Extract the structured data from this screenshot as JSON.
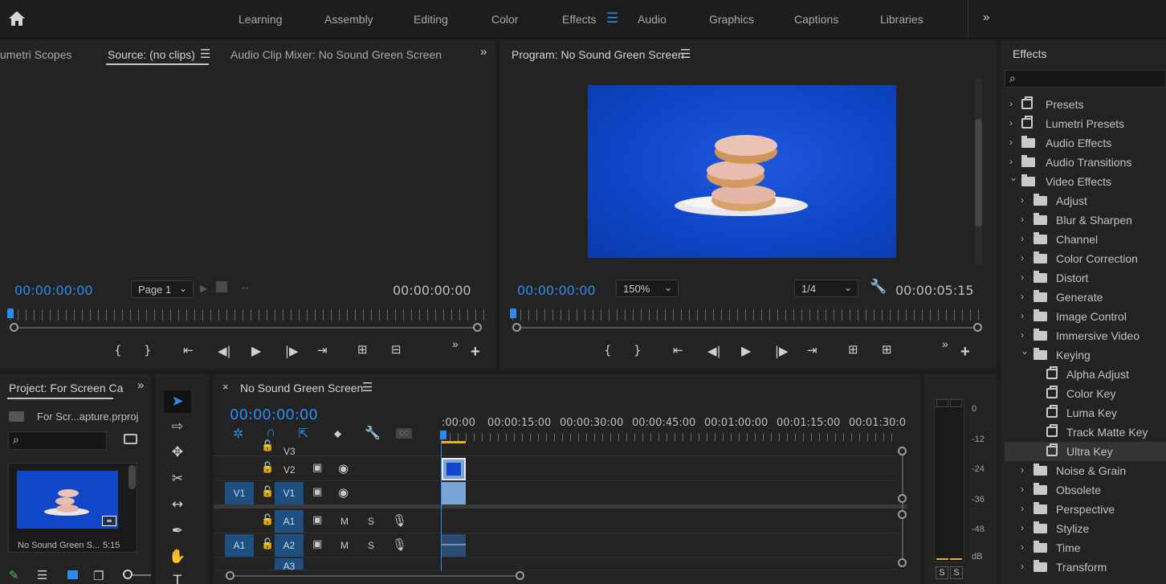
{
  "topbar": {
    "workspaces": [
      "Learning",
      "Assembly",
      "Editing",
      "Color",
      "Effects",
      "Audio",
      "Graphics",
      "Captions",
      "Libraries"
    ],
    "active": "Effects",
    "home_icon": "home-icon",
    "overflow_icon": "double-chevron-right-icon"
  },
  "source_panel": {
    "tabs": [
      "umetri Scopes",
      "Source: (no clips)",
      "Audio Clip Mixer: No Sound Green Screen"
    ],
    "timecode_in": "00:00:00:00",
    "page_select": "Page 1",
    "timecode_out": "00:00:00:00"
  },
  "program_panel": {
    "title": "Program: No Sound Green Screen",
    "timecode_in": "00:00:00:00",
    "zoom": "150%",
    "resolution": "1/4",
    "timecode_out": "00:00:05:15"
  },
  "effects_panel": {
    "title": "Effects",
    "search_placeholder": "",
    "items": [
      {
        "label": "Presets",
        "type": "fx",
        "level": 0,
        "expanded": false
      },
      {
        "label": "Lumetri Presets",
        "type": "fx",
        "level": 0,
        "expanded": false
      },
      {
        "label": "Audio Effects",
        "type": "folder",
        "level": 0,
        "expanded": false
      },
      {
        "label": "Audio Transitions",
        "type": "folder",
        "level": 0,
        "expanded": false
      },
      {
        "label": "Video Effects",
        "type": "folder",
        "level": 0,
        "expanded": true
      },
      {
        "label": "Adjust",
        "type": "folder",
        "level": 1,
        "expanded": false
      },
      {
        "label": "Blur & Sharpen",
        "type": "folder",
        "level": 1,
        "expanded": false
      },
      {
        "label": "Channel",
        "type": "folder",
        "level": 1,
        "expanded": false
      },
      {
        "label": "Color Correction",
        "type": "folder",
        "level": 1,
        "expanded": false
      },
      {
        "label": "Distort",
        "type": "folder",
        "level": 1,
        "expanded": false
      },
      {
        "label": "Generate",
        "type": "folder",
        "level": 1,
        "expanded": false
      },
      {
        "label": "Image Control",
        "type": "folder",
        "level": 1,
        "expanded": false
      },
      {
        "label": "Immersive Video",
        "type": "folder",
        "level": 1,
        "expanded": false
      },
      {
        "label": "Keying",
        "type": "folder",
        "level": 1,
        "expanded": true
      },
      {
        "label": "Alpha Adjust",
        "type": "effect",
        "level": 2
      },
      {
        "label": "Color Key",
        "type": "effect",
        "level": 2
      },
      {
        "label": "Luma Key",
        "type": "effect",
        "level": 2
      },
      {
        "label": "Track Matte Key",
        "type": "effect",
        "level": 2
      },
      {
        "label": "Ultra Key",
        "type": "effect",
        "level": 2,
        "selected": true
      },
      {
        "label": "Noise & Grain",
        "type": "folder",
        "level": 1,
        "expanded": false
      },
      {
        "label": "Obsolete",
        "type": "folder",
        "level": 1,
        "expanded": false
      },
      {
        "label": "Perspective",
        "type": "folder",
        "level": 1,
        "expanded": false
      },
      {
        "label": "Stylize",
        "type": "folder",
        "level": 1,
        "expanded": false
      },
      {
        "label": "Time",
        "type": "folder",
        "level": 1,
        "expanded": false
      },
      {
        "label": "Transform",
        "type": "folder",
        "level": 1,
        "expanded": false
      }
    ]
  },
  "project_panel": {
    "title": "Project: For Screen Ca",
    "file": "For Scr...apture.prproj",
    "clip_name": "No Sound Green S...",
    "clip_duration": "5:15"
  },
  "timeline": {
    "sequence_name": "No Sound Green Screen",
    "timecode": "00:00:00:00",
    "ruler_labels": [
      ":00:00",
      "00:00:15:00",
      "00:00:30:00",
      "00:00:45:00",
      "00:01:00:00",
      "00:01:15:00",
      "00:01:30:0"
    ],
    "video_tracks": [
      "V3",
      "V2",
      "V1"
    ],
    "audio_tracks": [
      "A1",
      "A2",
      "A3"
    ],
    "source_video_target": "V1",
    "source_audio_target": "A1",
    "mute_label": "M",
    "solo_label": "S"
  },
  "audio_meter": {
    "labels": [
      "0",
      "-12",
      "-24",
      "-36",
      "-48",
      "dB"
    ],
    "solo_buttons": [
      "S",
      "S"
    ]
  },
  "colors": {
    "accent": "#2d8ceb",
    "panel_bg": "#232323",
    "frame_bg": "#0f47c8",
    "clip_video": "#7aa3d6",
    "clip_audio": "#2c4a72"
  }
}
